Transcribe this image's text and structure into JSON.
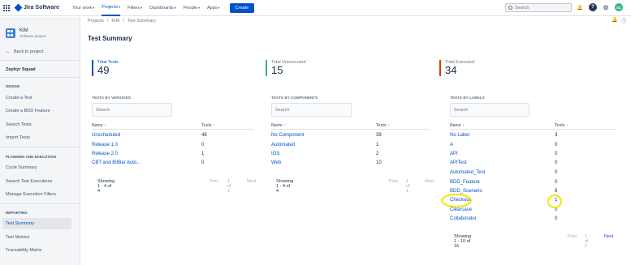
{
  "topbar": {
    "app_name": "Jira Software",
    "nav": [
      "Your work",
      "Projects",
      "Filters",
      "Dashboards",
      "People",
      "Apps"
    ],
    "active_nav": "Projects",
    "create_label": "Create",
    "search_placeholder": "Search",
    "avatar_initials": "SC",
    "icons": [
      "grid-icon",
      "bell-icon",
      "help-icon",
      "gear-icon"
    ]
  },
  "sidebar": {
    "project_name": "KIM",
    "project_type": "Software project",
    "back_label": "Back to project",
    "zephyr": "Zephyr Squad",
    "design_title": "DESIGN",
    "design_items": [
      "Create a Test",
      "Create a BDD Feature",
      "Search Tests",
      "Import Tests"
    ],
    "planning_title": "PLANNING AND EXECUTION",
    "planning_items": [
      "Cycle Summary",
      "Search Test Executions",
      "Manage Execution Filters"
    ],
    "reporting_title": "REPORTING",
    "reporting_items": [
      "Test Summary",
      "Test Metrics",
      "Traceability Matrix"
    ]
  },
  "breadcrumb": [
    "Projects",
    "/",
    "KIM",
    "/",
    "Test Summary"
  ],
  "page_title": "Test Summary",
  "summary": [
    {
      "label": "Total Tests",
      "value": "49",
      "color": "#0052cc"
    },
    {
      "label": "Total Unexecuted",
      "value": "15",
      "color": "#36b37e"
    },
    {
      "label": "Total Executed",
      "value": "34",
      "color": "#de350b"
    }
  ],
  "versions": {
    "title": "TESTS BY VERSIONS",
    "search_placeholder": "Search",
    "col_name": "Name ↑",
    "col_tests": "Tests ↑",
    "rows": [
      {
        "name": "Unscheduled",
        "tests": "48"
      },
      {
        "name": "Release 1.0",
        "tests": "0"
      },
      {
        "name": "Release 2.0",
        "tests": "1"
      },
      {
        "name": "CBT and BitBar Auto...",
        "tests": "0"
      }
    ],
    "showing": "Showing 1 - 4 of 4",
    "prev": "Prev",
    "page": "1 of 1",
    "next": "Next"
  },
  "components": {
    "title": "TESTS BY COMPONENTS",
    "search_placeholder": "Search",
    "col_name": "Name ↑",
    "col_tests": "Tests ↑",
    "rows": [
      {
        "name": "No Component",
        "tests": "39"
      },
      {
        "name": "Automated",
        "tests": "1"
      },
      {
        "name": "IOS",
        "tests": "2"
      },
      {
        "name": "Web",
        "tests": "10"
      }
    ],
    "showing": "Showing 1 - 4 of 4",
    "prev": "Prev",
    "page": "1 of 1",
    "next": "Next"
  },
  "labels": {
    "title": "TESTS BY LABELS",
    "search_placeholder": "Search",
    "col_name": "Name ↑",
    "col_tests": "Tests ↑",
    "rows": [
      {
        "name": "No Label",
        "tests": "3"
      },
      {
        "name": "A",
        "tests": "0"
      },
      {
        "name": "API",
        "tests": "0"
      },
      {
        "name": "APITest",
        "tests": "0"
      },
      {
        "name": "Automated_Test",
        "tests": "0"
      },
      {
        "name": "BDD_Feature",
        "tests": "0"
      },
      {
        "name": "BDD_Scenario",
        "tests": "8"
      },
      {
        "name": "Checkout",
        "tests": "1"
      },
      {
        "name": "Clearcase",
        "tests": "0"
      },
      {
        "name": "Collaborator",
        "tests": "0"
      }
    ],
    "showing": "Showing 1 - 10 of 16",
    "prev": "Prev",
    "page": "1 of 2",
    "next": "Next"
  }
}
